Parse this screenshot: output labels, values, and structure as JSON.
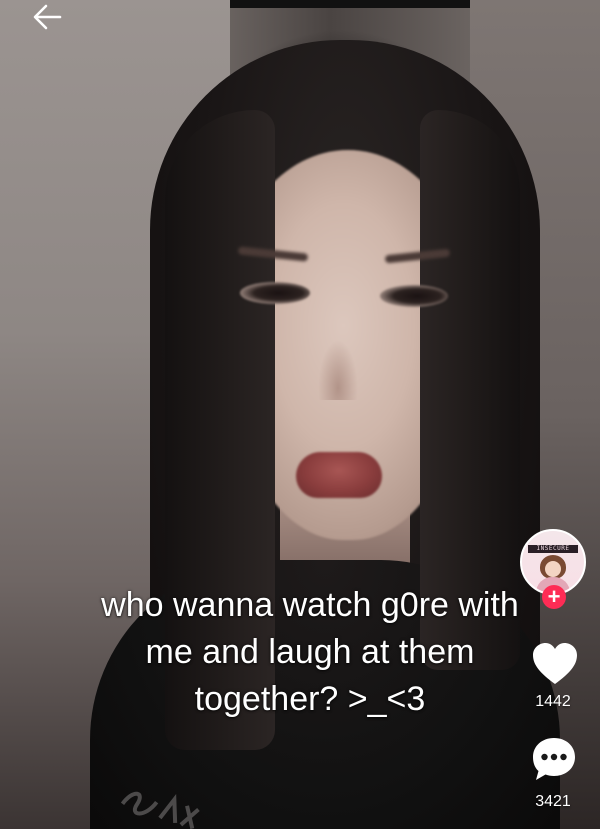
{
  "caption": {
    "line1": "who wanna watch g0re with",
    "line2": "me and laugh at them",
    "line3": "together? >_<3"
  },
  "creator_avatar": {
    "banner_text": "INSECURE"
  },
  "actions": {
    "like_count": "1442",
    "comment_count": "3421"
  },
  "icons": {
    "back": "back-arrow-icon",
    "follow": "plus-icon",
    "like": "heart-icon",
    "comment": "comment-bubble-icon"
  },
  "colors": {
    "follow_accent": "#fe2c55",
    "icon_fill": "#ffffff"
  }
}
